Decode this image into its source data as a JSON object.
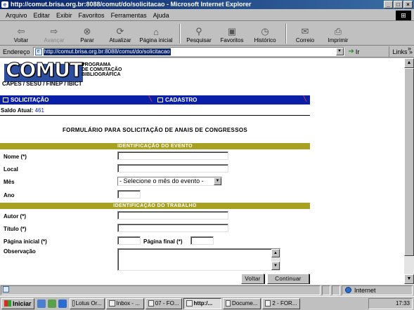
{
  "window": {
    "title": "http://comut.brisa.org.br:8088/comut/do/solicitacao - Microsoft Internet Explorer"
  },
  "menu": [
    "Arquivo",
    "Editar",
    "Exibir",
    "Favoritos",
    "Ferramentas",
    "Ajuda"
  ],
  "toolbar": {
    "back": "Voltar",
    "forward": "Avançar",
    "stop": "Parar",
    "refresh": "Atualizar",
    "home": "Página inicial",
    "search": "Pesquisar",
    "favorites": "Favoritos",
    "history": "Histórico",
    "mail": "Correio",
    "print": "Imprimir"
  },
  "address": {
    "label": "Endereço",
    "url": "http://comut.brisa.org.br:8088/comut/do/solicitacao",
    "go": "Ir",
    "links": "Links"
  },
  "page": {
    "logo": {
      "word": "COMUT",
      "sub1": "PROGRAMA",
      "sub2": "DE COMUTAÇÃO",
      "sub3": "BIBLIOGRÁFICA",
      "partners": "CAPES / SESU / FINEP / IBICT"
    },
    "nav": {
      "solicitacao": "SOLICITAÇÃO",
      "cadastro": "CADASTRO"
    },
    "saldo": {
      "label": "Saldo Atual:",
      "value": "461"
    },
    "form_title": "FORMULÁRIO PARA SOLICITAÇÃO DE ANAIS DE CONGRESSOS",
    "section_event": "IDENTIFICAÇÃO DO EVENTO",
    "section_work": "IDENTIFICAÇÃO DO TRABALHO",
    "fields": {
      "nome": "Nome (*)",
      "local": "Local",
      "mes": "Mês",
      "mes_selected": "- Selecione o mês do evento -",
      "ano": "Ano",
      "autor": "Autor (*)",
      "titulo": "Título (*)",
      "pagina_inicial": "Página inicial (*)",
      "pagina_final": "Página final (*)",
      "observacao": "Observação"
    },
    "buttons": {
      "voltar": "Voltar",
      "continuar": "Continuar"
    }
  },
  "status": {
    "zone": "Internet"
  },
  "taskbar": {
    "start": "Iniciar",
    "tasks": [
      "Lotus Or...",
      "Inbox - ...",
      "07 - FO...",
      "http:/...",
      "Docume...",
      "2 - FOR..."
    ],
    "clock": "17:33"
  },
  "colors": {
    "nav_blue": "#0a1fa8",
    "section_olive": "#a8a11f",
    "title_blue": "#0a246a"
  }
}
